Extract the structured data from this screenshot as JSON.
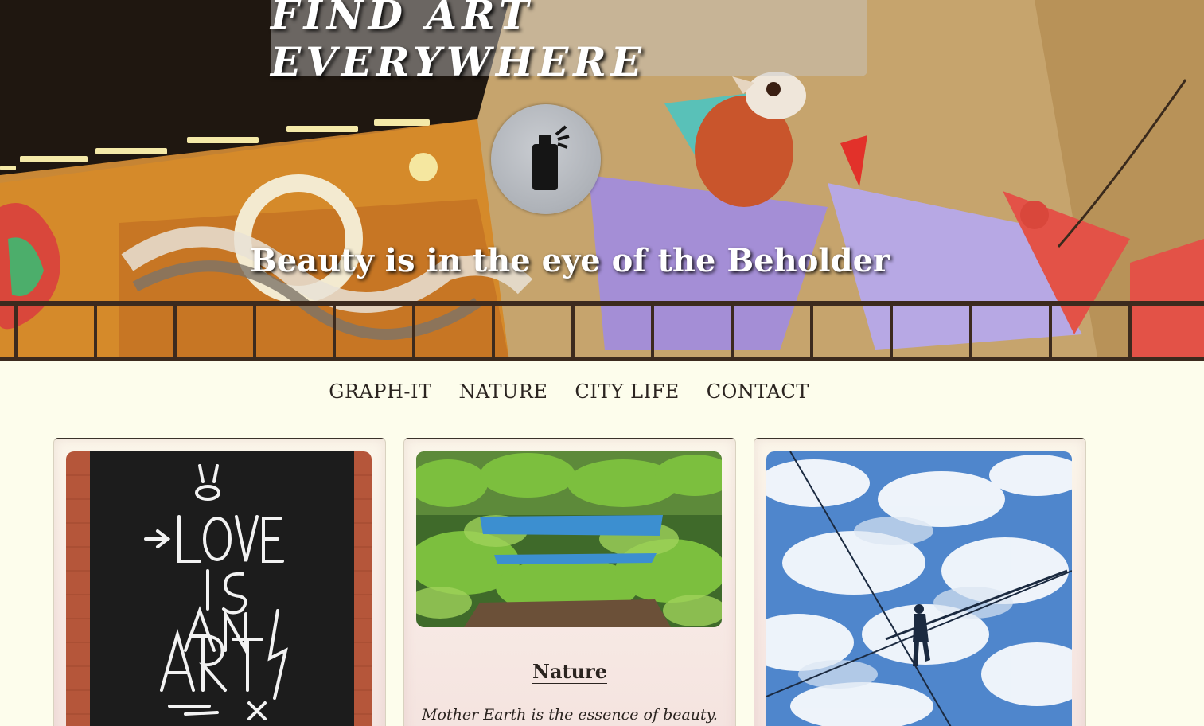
{
  "header": {
    "title": "FIND ART EVERYWHERE",
    "tagline": "Beauty is in the eye of the Beholder",
    "logo_icon": "spray-can-icon"
  },
  "nav": {
    "items": [
      {
        "label": "GRAPH-IT"
      },
      {
        "label": "NATURE"
      },
      {
        "label": "CITY LIFE"
      },
      {
        "label": "CONTACT"
      }
    ]
  },
  "cards": [
    {
      "image": "love-is-an-art-graffiti-photo",
      "title": "",
      "text": ""
    },
    {
      "image": "blue-bench-in-greenery-photo",
      "title": "Nature",
      "text": "Mother Earth is the essence of beauty."
    },
    {
      "image": "tightrope-walker-sky-photo",
      "title": "",
      "text": ""
    }
  ],
  "colors": {
    "background": "#fdfdec",
    "text": "#2b2420",
    "title_box": "rgba(200,200,200,0.45)"
  }
}
